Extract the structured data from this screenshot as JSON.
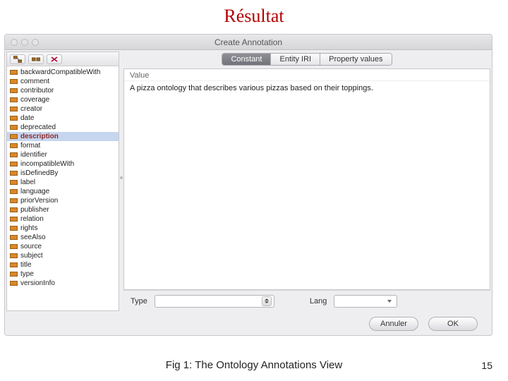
{
  "slide": {
    "title": "Résultat",
    "caption": "Fig 1: The Ontology Annotations View",
    "page": "15"
  },
  "window": {
    "title": "Create Annotation"
  },
  "tabs": {
    "items": [
      "Constant",
      "Entity IRI",
      "Property values"
    ],
    "active": 0
  },
  "value": {
    "header": "Value",
    "text": "A pizza ontology that describes various pizzas based on their toppings."
  },
  "fields": {
    "type_label": "Type",
    "lang_label": "Lang"
  },
  "buttons": {
    "cancel": "Annuler",
    "ok": "OK"
  },
  "properties": [
    "backwardCompatibleWith",
    "comment",
    "contributor",
    "coverage",
    "creator",
    "date",
    "deprecated",
    "description",
    "format",
    "identifier",
    "incompatibleWith",
    "isDefinedBy",
    "label",
    "language",
    "priorVersion",
    "publisher",
    "relation",
    "rights",
    "seeAlso",
    "source",
    "subject",
    "title",
    "type",
    "versionInfo"
  ],
  "selected_property": "description"
}
